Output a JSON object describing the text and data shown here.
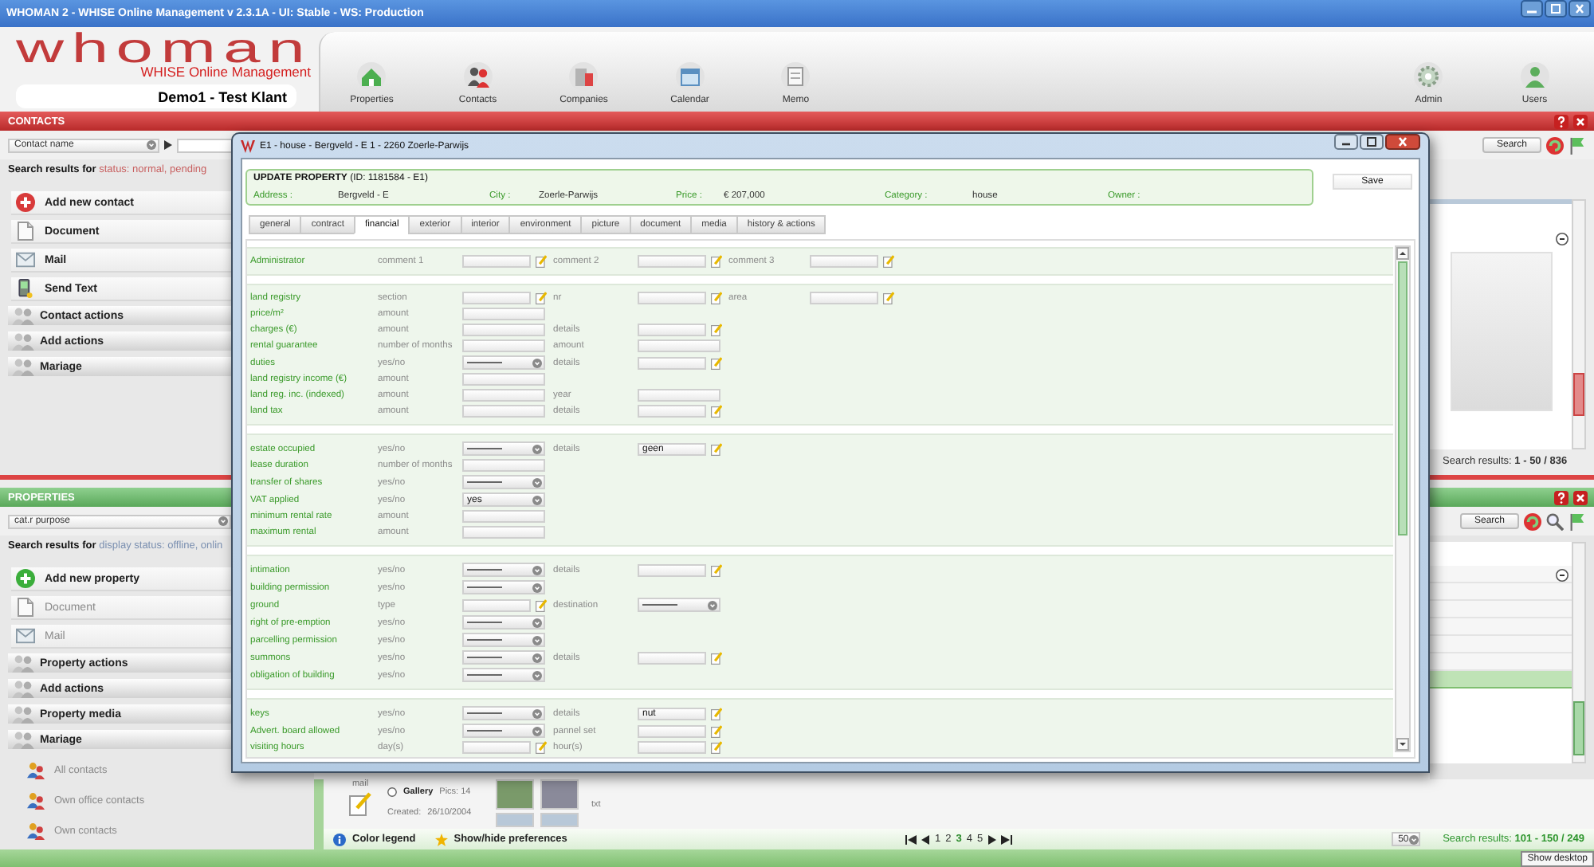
{
  "window": {
    "title": "WHOMAN 2 - WHISE Online Management v 2.3.1A - UI: Stable - WS: Production"
  },
  "header": {
    "logo": "whoman",
    "product": "WHISE Online Management",
    "account": "Demo1 - Test Klant",
    "nav": [
      {
        "label": "Properties"
      },
      {
        "label": "Contacts"
      },
      {
        "label": "Companies"
      },
      {
        "label": "Calendar"
      },
      {
        "label": "Memo"
      }
    ],
    "admin_nav": [
      {
        "label": "Admin"
      },
      {
        "label": "Users"
      }
    ]
  },
  "contacts": {
    "title": "CONTACTS",
    "filter": {
      "value": "Contact name"
    },
    "search_button": "Search",
    "search_label": "Search results for",
    "search_criteria": "status: normal, pending",
    "actions": [
      {
        "kind": "add",
        "label": "Add new contact",
        "color": "#d83a3a",
        "disabled": false
      },
      {
        "kind": "document",
        "label": "Document",
        "disabled": false
      },
      {
        "kind": "mail",
        "label": "Mail",
        "disabled": false
      },
      {
        "kind": "text",
        "label": "Send Text",
        "disabled": false
      },
      {
        "kind": "group",
        "label": "Contact actions",
        "disabled": false
      },
      {
        "kind": "group",
        "label": "Add actions",
        "disabled": false
      },
      {
        "kind": "group",
        "label": "Mariage",
        "disabled": false
      }
    ],
    "results": "Search results: **1 - 50 / 836**"
  },
  "properties": {
    "title": "PROPERTIES",
    "filter": {
      "value": "cat.r purpose"
    },
    "search_button": "Search",
    "search_label": "Search results for",
    "search_criteria": "display status: offline, onlin",
    "actions": [
      {
        "kind": "add",
        "label": "Add new property",
        "color": "#3cae3c",
        "disabled": false
      },
      {
        "kind": "document",
        "label": "Document",
        "disabled": true
      },
      {
        "kind": "mail",
        "label": "Mail",
        "disabled": true
      },
      {
        "kind": "group",
        "label": "Property actions",
        "disabled": false
      },
      {
        "kind": "group",
        "label": "Add actions",
        "disabled": false
      },
      {
        "kind": "group",
        "label": "Property media",
        "disabled": false
      },
      {
        "kind": "group",
        "label": "Mariage",
        "disabled": false
      }
    ],
    "contact_filters": [
      {
        "label": "All contacts"
      },
      {
        "label": "Own office contacts"
      },
      {
        "label": "Own contacts"
      }
    ],
    "list_rows": [
      {
        "selected": false
      },
      {
        "selected": false
      },
      {
        "selected": false
      },
      {
        "selected": false
      },
      {
        "selected": false
      },
      {
        "selected": false
      },
      {
        "selected": true
      }
    ],
    "listing": {
      "column_1": "mail",
      "gallery": "Gallery",
      "pics": "Pics: 14",
      "created_label": "Created:",
      "created": "26/10/2004",
      "column_2": "txt"
    },
    "footer": {
      "color_legend": "Color legend",
      "preferences": "Show/hide preferences",
      "pages": [
        {
          "label": "1",
          "selected": false
        },
        {
          "label": "2",
          "selected": false
        },
        {
          "label": "3",
          "selected": true
        },
        {
          "label": "4",
          "selected": false
        },
        {
          "label": "5",
          "selected": false
        }
      ],
      "page_size": "50",
      "results": "Search results: **101 - 150 / 249**"
    }
  },
  "dialog": {
    "title": "E1 - house - Bergveld - E 1 - 2260 Zoerle-Parwijs",
    "heading": "**UPDATE PROPERTY** (ID: 1181584 - E1)",
    "info": [
      {
        "label": "Address :",
        "value": "Bergveld - E"
      },
      {
        "label": "City :",
        "value": "Zoerle-Parwijs"
      },
      {
        "label": "Price :",
        "value": "€ 207,000"
      },
      {
        "label": "Category :",
        "value": "house"
      },
      {
        "label": "Owner :"
      }
    ],
    "save_button": "Save",
    "tabs": [
      {
        "label": "general",
        "selected": false
      },
      {
        "label": "contract",
        "selected": false
      },
      {
        "label": "financial",
        "selected": true
      },
      {
        "label": "exterior",
        "selected": false
      },
      {
        "label": "interior",
        "selected": false
      },
      {
        "label": "environment",
        "selected": false
      },
      {
        "label": "picture",
        "selected": false
      },
      {
        "label": "document",
        "selected": false
      },
      {
        "label": "media",
        "selected": false
      },
      {
        "label": "history & actions",
        "selected": false
      }
    ],
    "sections": [
      {
        "rows": [
          {
            "label": "Administrator",
            "fields": [
              {
                "label": "comment 1",
                "kind": "text",
                "edit": true
              },
              {
                "label": "comment 2",
                "kind": "text",
                "edit": true
              },
              {
                "label": "comment 3",
                "kind": "text",
                "edit": true
              }
            ]
          }
        ]
      },
      {
        "rows": [
          {
            "label": "land registry",
            "fields": [
              {
                "label": "section",
                "kind": "text",
                "edit": true
              },
              {
                "label": "nr",
                "kind": "text",
                "edit": true
              },
              {
                "label": "area",
                "kind": "text",
                "edit": true
              }
            ]
          },
          {
            "label": "price/m²",
            "fields": [
              {
                "label": "amount",
                "kind": "text",
                "edit": false
              }
            ]
          },
          {
            "label": "charges (€)",
            "fields": [
              {
                "label": "amount",
                "kind": "text",
                "edit": false
              },
              {
                "label": "details",
                "kind": "text",
                "edit": true
              }
            ]
          },
          {
            "label": "rental guarantee",
            "fields": [
              {
                "label": "number of months",
                "kind": "text",
                "edit": false
              },
              {
                "label": "amount",
                "kind": "text",
                "edit": false
              }
            ]
          },
          {
            "label": "duties",
            "fields": [
              {
                "label": "yes/no",
                "kind": "select",
                "edit": false
              },
              {
                "label": "details",
                "kind": "text",
                "edit": true
              }
            ]
          },
          {
            "label": "land registry income (€)",
            "fields": [
              {
                "label": "amount",
                "kind": "text",
                "edit": false
              }
            ]
          },
          {
            "label": "land reg. inc. (indexed)",
            "fields": [
              {
                "label": "amount",
                "kind": "text",
                "edit": false
              },
              {
                "label": "year",
                "kind": "text",
                "edit": false
              }
            ]
          },
          {
            "label": "land tax",
            "fields": [
              {
                "label": "amount",
                "kind": "text",
                "edit": false
              },
              {
                "label": "details",
                "kind": "text",
                "edit": true
              }
            ]
          }
        ]
      },
      {
        "rows": [
          {
            "label": "estate occupied",
            "fields": [
              {
                "label": "yes/no",
                "kind": "select",
                "edit": false
              },
              {
                "label": "details",
                "kind": "text",
                "edit": true,
                "value": "geen"
              }
            ]
          },
          {
            "label": "lease duration",
            "fields": [
              {
                "label": "number of months",
                "kind": "text",
                "edit": false
              }
            ]
          },
          {
            "label": "transfer of shares",
            "fields": [
              {
                "label": "yes/no",
                "kind": "select",
                "edit": false
              }
            ]
          },
          {
            "label": "VAT applied",
            "fields": [
              {
                "label": "yes/no",
                "kind": "select",
                "edit": false,
                "value": "yes"
              }
            ]
          },
          {
            "label": "minimum rental rate",
            "fields": [
              {
                "label": "amount",
                "kind": "text",
                "edit": false
              }
            ]
          },
          {
            "label": "maximum rental",
            "fields": [
              {
                "label": "amount",
                "kind": "text",
                "edit": false
              }
            ]
          }
        ]
      },
      {
        "rows": [
          {
            "label": "intimation",
            "fields": [
              {
                "label": "yes/no",
                "kind": "select",
                "edit": false
              },
              {
                "label": "details",
                "kind": "text",
                "edit": true
              }
            ]
          },
          {
            "label": "building permission",
            "fields": [
              {
                "label": "yes/no",
                "kind": "select",
                "edit": false
              }
            ]
          },
          {
            "label": "ground",
            "fields": [
              {
                "label": "type",
                "kind": "text",
                "edit": true
              },
              {
                "label": "destination",
                "kind": "select",
                "edit": false
              }
            ]
          },
          {
            "label": "right of pre-emption",
            "fields": [
              {
                "label": "yes/no",
                "kind": "select",
                "edit": false
              }
            ]
          },
          {
            "label": "parcelling permission",
            "fields": [
              {
                "label": "yes/no",
                "kind": "select",
                "edit": false
              }
            ]
          },
          {
            "label": "summons",
            "fields": [
              {
                "label": "yes/no",
                "kind": "select",
                "edit": false
              },
              {
                "label": "details",
                "kind": "text",
                "edit": true
              }
            ]
          },
          {
            "label": "obligation of building",
            "fields": [
              {
                "label": "yes/no",
                "kind": "select",
                "edit": false
              }
            ]
          }
        ]
      },
      {
        "rows": [
          {
            "label": "keys",
            "fields": [
              {
                "label": "yes/no",
                "kind": "select",
                "edit": false
              },
              {
                "label": "details",
                "kind": "text",
                "edit": true,
                "value": "nut"
              }
            ]
          },
          {
            "label": "Advert. board allowed",
            "fields": [
              {
                "label": "yes/no",
                "kind": "select",
                "edit": false
              },
              {
                "label": "pannel set",
                "kind": "text",
                "edit": true
              }
            ]
          },
          {
            "label": "visiting hours",
            "fields": [
              {
                "label": "day(s)",
                "kind": "text",
                "edit": true
              },
              {
                "label": "hour(s)",
                "kind": "text",
                "edit": true
              }
            ]
          }
        ]
      }
    ]
  },
  "tooltip": "Show desktop"
}
